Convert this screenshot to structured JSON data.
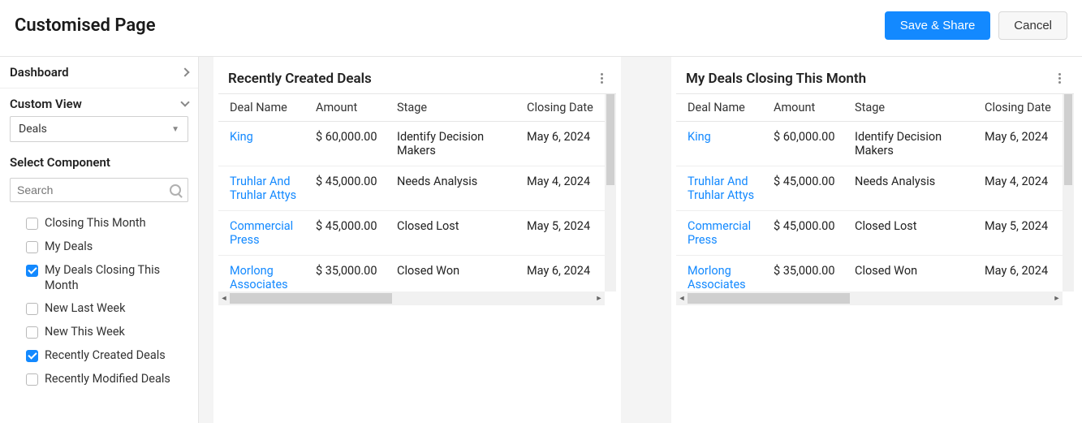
{
  "header": {
    "title": "Customised Page",
    "save_share": "Save & Share",
    "cancel": "Cancel"
  },
  "sidebar": {
    "dashboard_label": "Dashboard",
    "custom_view_label": "Custom View",
    "module_selected": "Deals",
    "select_component_label": "Select Component",
    "search_placeholder": "Search",
    "components": [
      {
        "label": "Closing This Month",
        "checked": false
      },
      {
        "label": "My Deals",
        "checked": false
      },
      {
        "label": "My Deals Closing This Month",
        "checked": true
      },
      {
        "label": "New Last Week",
        "checked": false
      },
      {
        "label": "New This Week",
        "checked": false
      },
      {
        "label": "Recently Created Deals",
        "checked": true
      },
      {
        "label": "Recently Modified Deals",
        "checked": false
      }
    ]
  },
  "widgets": [
    {
      "title": "Recently Created Deals",
      "columns": [
        "Deal Name",
        "Amount",
        "Stage",
        "Closing Date"
      ],
      "rows": [
        {
          "deal": "King",
          "amount": "$ 60,000.00",
          "stage": "Identify Decision Makers",
          "closing": "May 6, 2024"
        },
        {
          "deal": "Truhlar And Truhlar Attys",
          "amount": "$ 45,000.00",
          "stage": "Needs Analysis",
          "closing": "May 4, 2024"
        },
        {
          "deal": "Commercial Press",
          "amount": "$ 45,000.00",
          "stage": "Closed Lost",
          "closing": "May 5, 2024"
        },
        {
          "deal": "Morlong Associates",
          "amount": "$ 35,000.00",
          "stage": "Closed Won",
          "closing": "May 6, 2024"
        }
      ]
    },
    {
      "title": "My Deals Closing This Month",
      "columns": [
        "Deal Name",
        "Amount",
        "Stage",
        "Closing Date"
      ],
      "rows": [
        {
          "deal": "King",
          "amount": "$ 60,000.00",
          "stage": "Identify Decision Makers",
          "closing": "May 6, 2024"
        },
        {
          "deal": "Truhlar And Truhlar Attys",
          "amount": "$ 45,000.00",
          "stage": "Needs Analysis",
          "closing": "May 4, 2024"
        },
        {
          "deal": "Commercial Press",
          "amount": "$ 45,000.00",
          "stage": "Closed Lost",
          "closing": "May 5, 2024"
        },
        {
          "deal": "Morlong Associates",
          "amount": "$ 35,000.00",
          "stage": "Closed Won",
          "closing": "May 6, 2024"
        }
      ]
    }
  ]
}
